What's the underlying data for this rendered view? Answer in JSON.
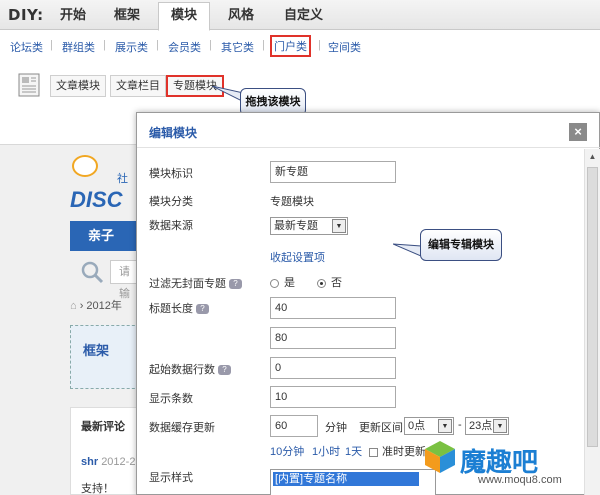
{
  "diy": {
    "label": "DIY:",
    "tabs": [
      "开始",
      "框架",
      "模块",
      "风格",
      "自定义"
    ],
    "active_tab": "模块"
  },
  "categories": {
    "links": [
      "论坛类",
      "群组类",
      "展示类",
      "会员类",
      "其它类",
      "门户类",
      "空间类"
    ],
    "active": "门户类"
  },
  "modules": {
    "buttons": [
      "文章模块",
      "文章栏目",
      "专题模块"
    ],
    "active": "专题模块"
  },
  "callouts": {
    "drag": "拖拽该模块",
    "edit": "编辑专辑模块"
  },
  "background_page": {
    "logo_text": "DISC",
    "logo_small": "社",
    "nav_item": "亲子",
    "search_placeholder": "请输",
    "breadcrumb": "› 2012年",
    "frame_label": "框架",
    "comments_title": "最新评论",
    "comment_user": "shr",
    "comment_date": "2012-2-",
    "comment_text": "支持！"
  },
  "dialog": {
    "title": "编辑模块",
    "close": "×",
    "fields": {
      "module_id_label": "模块标识",
      "module_id_value": "新专题",
      "category_label": "模块分类",
      "category_value": "专题模块",
      "source_label": "数据来源",
      "source_value": "最新专题",
      "collapse_link": "收起设置项",
      "filter_label": "过滤无封面专题",
      "filter_yes": "是",
      "filter_no": "否",
      "title_len_label": "标题长度",
      "title_len_value": "40",
      "summary_len_value": "80",
      "start_row_label": "起始数据行数",
      "start_row_value": "0",
      "count_label": "显示条数",
      "count_value": "10",
      "cache_label": "数据缓存更新",
      "cache_value": "60",
      "cache_unit": "分钟",
      "range_label": "更新区间",
      "range_from": "0点",
      "range_dash": "-",
      "range_to": "23点",
      "quick_10": "10分钟",
      "quick_1h": "1小时",
      "quick_1d": "1天",
      "exact_update": "准时更新",
      "style_label": "显示样式",
      "style_value": "[内置]专题名称"
    }
  },
  "watermark": {
    "text": "魔趣吧",
    "url": "www.moqu8.com"
  },
  "colors": {
    "accent_red": "#e0322a",
    "link_blue": "#2b5ba9",
    "nav_blue": "#2a66b5",
    "selection_blue": "#3177d8"
  }
}
